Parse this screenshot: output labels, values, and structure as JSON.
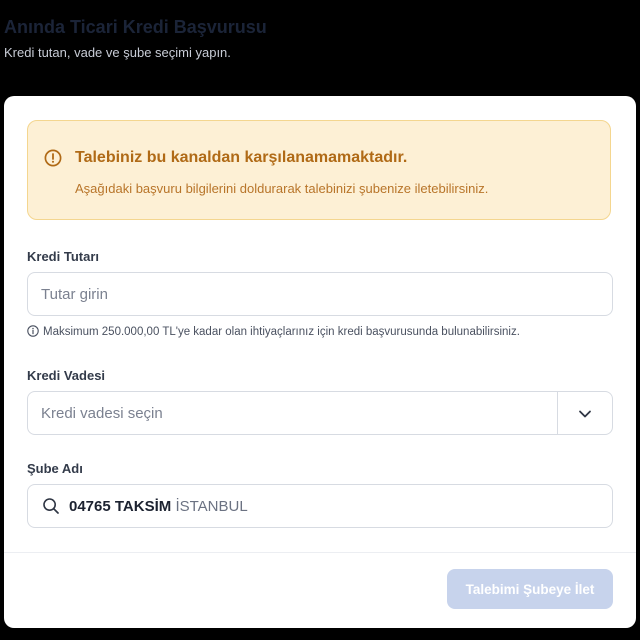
{
  "header": {
    "title": "Anında Ticari Kredi Başvurusu",
    "subtitle": "Kredi tutan, vade ve şube seçimi yapın."
  },
  "alert": {
    "icon": "alert-circle-icon",
    "title": "Talebiniz bu kanaldan karşılanamamaktadır.",
    "message": "Aşağıdaki başvuru bilgilerini doldurarak talebinizi şubenize iletebilirsiniz.",
    "background_color": "#fdf0d5",
    "text_color": "#b06a16"
  },
  "form": {
    "amount": {
      "label": "Kredi Tutarı",
      "value": "",
      "placeholder": "Tutar girin",
      "hint_icon": "info-icon",
      "hint": "Maksimum 250.000,00 TL'ye kadar olan ihtiyaçlarınız için kredi başvurusunda bulunabilirsiniz."
    },
    "term": {
      "label": "Kredi Vadesi",
      "selected": "",
      "placeholder": "Kredi vadesi seçin",
      "icon": "chevron-down-icon"
    },
    "branch": {
      "label": "Şube Adı",
      "icon": "search-icon",
      "code": "04765 TAKSİM",
      "city": "İSTANBUL"
    }
  },
  "footer": {
    "submit_label": "Talebimi Şubeye İlet",
    "submit_enabled": false,
    "submit_color": "#c7d3ec"
  }
}
